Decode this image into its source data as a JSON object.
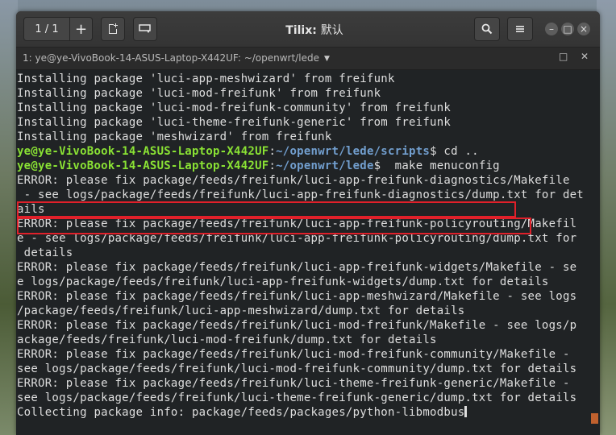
{
  "headerbar": {
    "session_counter": "1 / 1",
    "plus_label": "+",
    "title_app": "Tilix:",
    "title_session": "默认",
    "icons": [
      "new-session-icon",
      "sidebar-icon",
      "search-icon",
      "menu-icon",
      "minimize-icon",
      "maximize-icon",
      "close-icon"
    ]
  },
  "terminal_title": {
    "text": "1: ye@ye-VivoBook-14-ASUS-Laptop-X442UF: ~/openwrt/lede"
  },
  "terminal": {
    "lines": [
      "Installing package 'luci-app-meshwizard' from freifunk",
      "Installing package 'luci-mod-freifunk' from freifunk",
      "Installing package 'luci-mod-freifunk-community' from freifunk",
      "Installing package 'luci-theme-freifunk-generic' from freifunk",
      "Installing package 'meshwizard' from freifunk"
    ],
    "prompt1": {
      "user": "ye@ye-VivoBook-14-ASUS-Laptop-X442UF",
      "sep": ":",
      "path": "~/openwrt/lede/scripts",
      "cmd": "$ cd .."
    },
    "prompt2": {
      "user": "ye@ye-VivoBook-14-ASUS-Laptop-X442UF",
      "sep": ":",
      "path": "~/openwrt/lede",
      "cmd": "$  make menuconfig"
    },
    "output": [
      "ERROR: please fix package/feeds/freifunk/luci-app-freifunk-diagnostics/Makefile",
      " - see logs/package/feeds/freifunk/luci-app-freifunk-diagnostics/dump.txt for det",
      "ails",
      "ERROR: please fix package/feeds/freifunk/luci-app-freifunk-policyrouting/Makefil",
      "e - see logs/package/feeds/freifunk/luci-app-freifunk-policyrouting/dump.txt for",
      " details",
      "ERROR: please fix package/feeds/freifunk/luci-app-freifunk-widgets/Makefile - se",
      "e logs/package/feeds/freifunk/luci-app-freifunk-widgets/dump.txt for details",
      "ERROR: please fix package/feeds/freifunk/luci-app-meshwizard/Makefile - see logs",
      "/package/feeds/freifunk/luci-app-meshwizard/dump.txt for details",
      "ERROR: please fix package/feeds/freifunk/luci-mod-freifunk/Makefile - see logs/p",
      "ackage/feeds/freifunk/luci-mod-freifunk/dump.txt for details",
      "ERROR: please fix package/feeds/freifunk/luci-mod-freifunk-community/Makefile -",
      "see logs/package/feeds/freifunk/luci-mod-freifunk-community/dump.txt for details",
      "ERROR: please fix package/feeds/freifunk/luci-theme-freifunk-generic/Makefile -",
      "see logs/package/feeds/freifunk/luci-theme-freifunk-generic/dump.txt for details",
      "Collecting package info: package/feeds/packages/python-libmodbus"
    ]
  },
  "colors": {
    "prompt_user": "#8ae234",
    "prompt_path": "#729fcf",
    "highlight_box": "#e0202a",
    "scrollbar": "#c0612e"
  }
}
